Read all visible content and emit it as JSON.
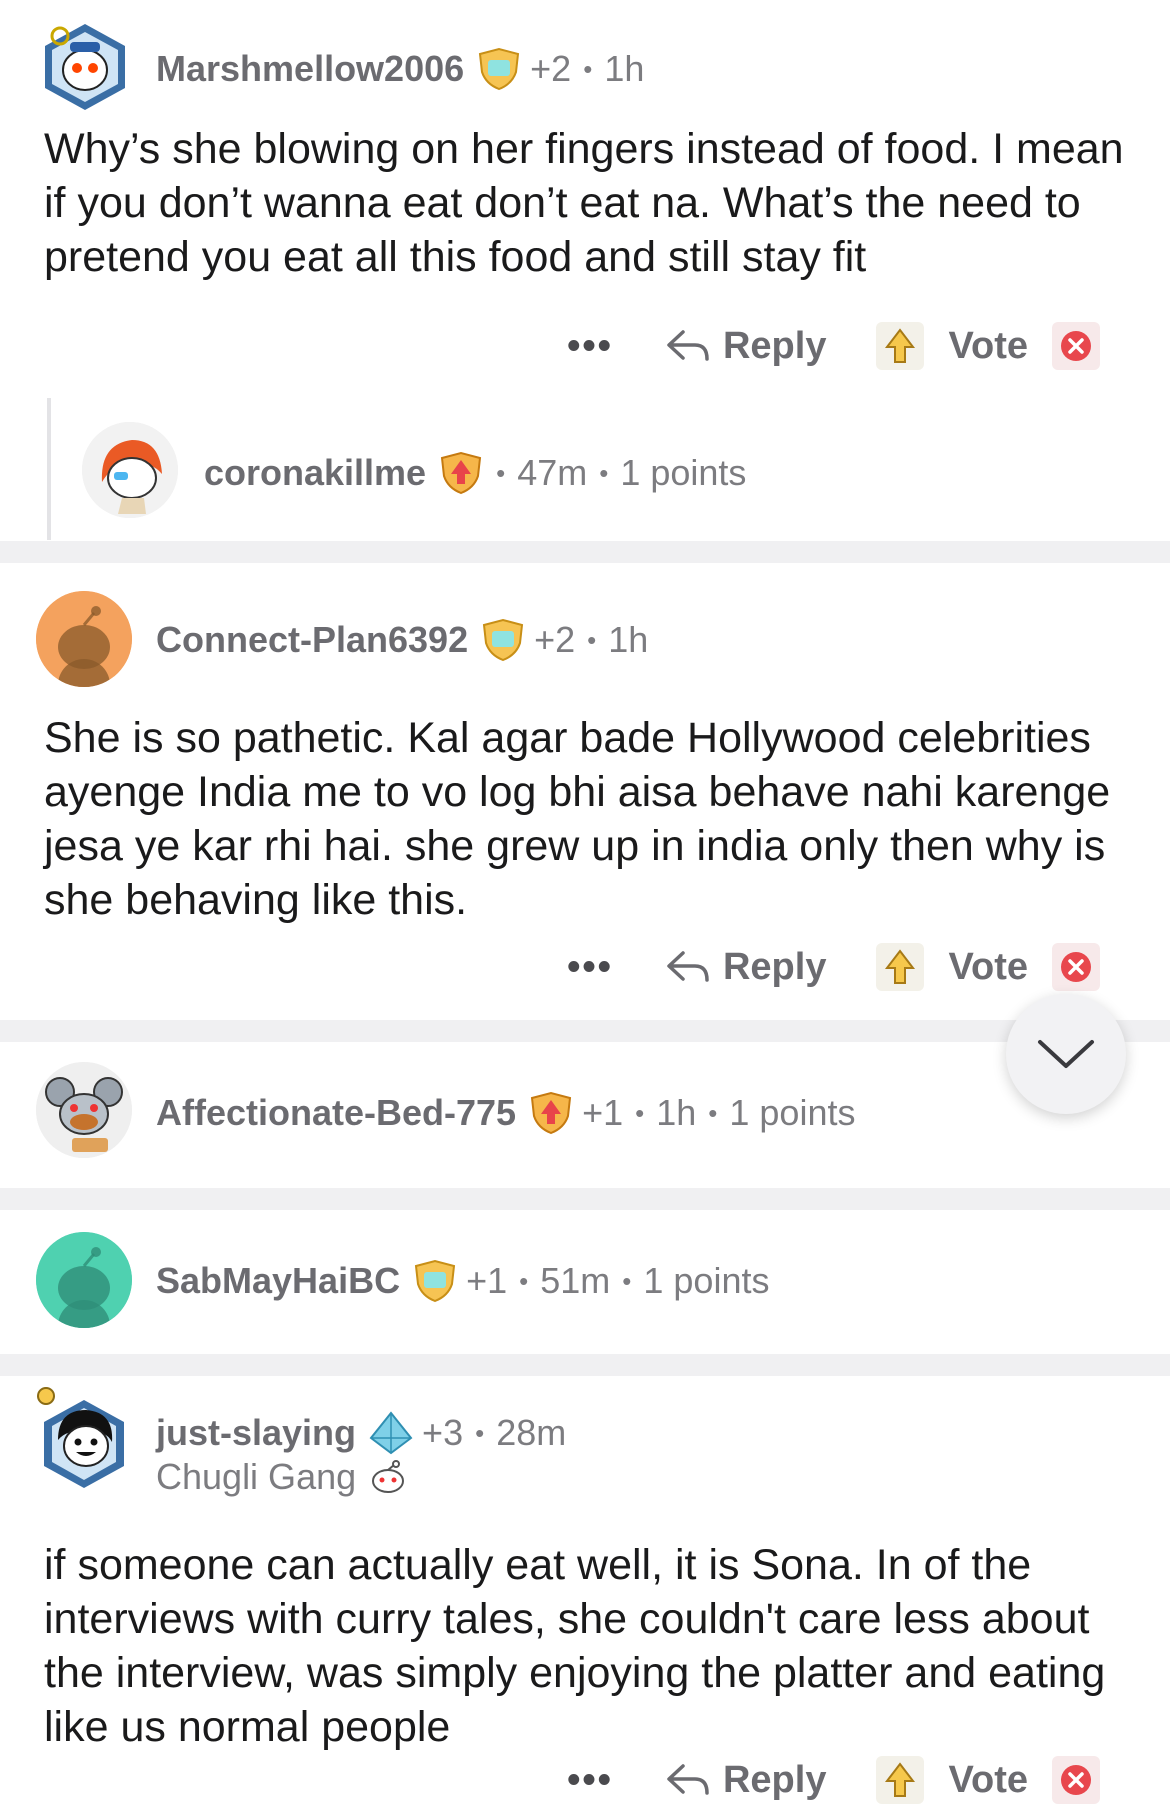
{
  "comments": [
    {
      "username": "Marshmellow2006",
      "score": "+2",
      "time": "1h",
      "body": "Why’s she blowing on her fingers instead of food. I mean if you don’t wanna eat don’t eat na. What’s the need to pretend you eat all this food and still stay fit",
      "avatar_icon": "snoo-avatar-icon"
    },
    {
      "username": "coronakillme",
      "time": "47m",
      "points": "1 points",
      "avatar_icon": "snoo-avatar-icon"
    },
    {
      "username": "Connect-Plan6392",
      "score": "+2",
      "time": "1h",
      "body": "She is so pathetic. Kal agar bade Hollywood celebrities ayenge India me to vo log bhi aisa behave nahi karenge jesa ye kar rhi hai. she grew up in india only then why is she behaving like this.",
      "avatar_icon": "snoo-avatar-icon"
    },
    {
      "username": "Affectionate-Bed-775",
      "score": "+1",
      "time": "1h",
      "points": "1 points",
      "avatar_icon": "snoo-avatar-icon"
    },
    {
      "username": "SabMayHaiBC",
      "score": "+1",
      "time": "51m",
      "points": "1 points",
      "avatar_icon": "snoo-avatar-icon"
    },
    {
      "username": "just-slaying",
      "score": "+3",
      "time": "28m",
      "flair": "Chugli Gang",
      "body": "if someone can actually eat well, it is Sona. In of the interviews with curry tales, she couldn't care less about the interview, was simply enjoying the platter and eating like us normal people",
      "avatar_icon": "snoo-avatar-icon"
    }
  ],
  "actions": {
    "more": "•••",
    "reply": "Reply",
    "vote": "Vote"
  },
  "separator_dot": "•",
  "colors": {
    "separator": "#f0f0f2",
    "meta_text": "#7c7c80",
    "body_text": "#1a1a1b",
    "avatar_orange": "#f4a25e",
    "avatar_teal": "#4fd1b0"
  }
}
